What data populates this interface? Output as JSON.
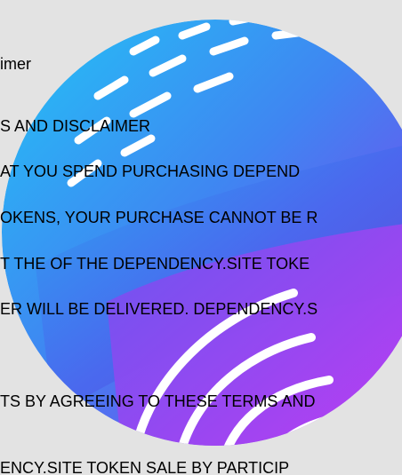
{
  "lines": [
    "imer",
    "S AND DISCLAIMER",
    "AT YOU SPEND PURCHASING DEPEND",
    "OKENS, YOUR PURCHASE CANNOT BE R",
    "T THE  OF THE DEPENDENCY.SITE TOKE",
    "ER WILL BE DELIVERED. DEPENDENCY.S",
    "TS BY AGREEING TO THESE TERMS AND",
    "ENCY.SITE   TOKEN SALE  BY PARTICIP"
  ],
  "colors": {
    "background": "#e3e3e3",
    "sphere_top": "#2bbcf3",
    "sphere_mid": "#4b73f0",
    "sphere_bottom": "#b53cf2"
  }
}
